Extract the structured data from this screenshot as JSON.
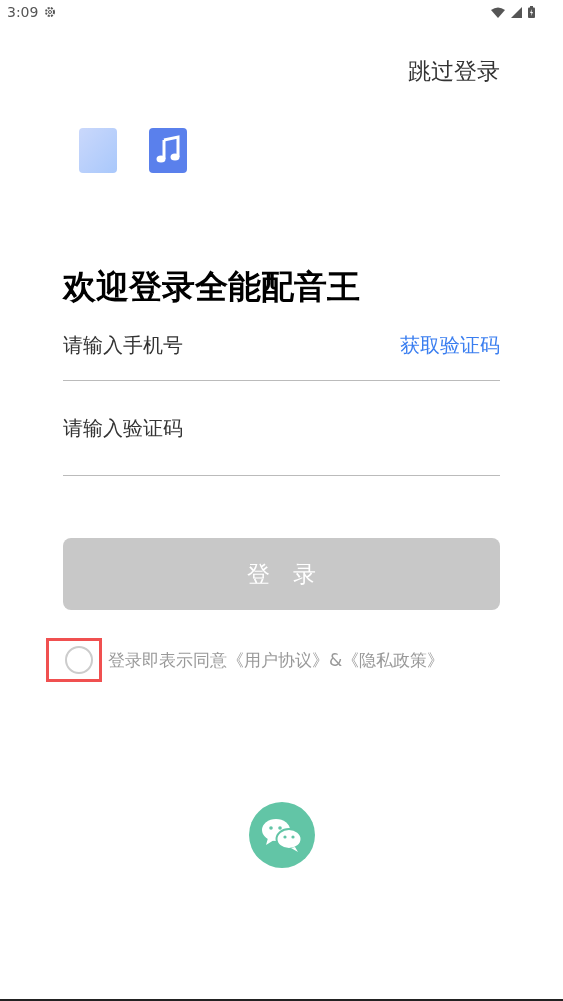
{
  "status_bar": {
    "time": "3:09"
  },
  "skip": "跳过登录",
  "title": "欢迎登录全能配音王",
  "phone_field": {
    "placeholder": "请输入手机号",
    "action": "获取验证码"
  },
  "code_field": {
    "placeholder": "请输入验证码"
  },
  "login_button": {
    "label": "登　录",
    "disabled": true
  },
  "agreement": {
    "checked": false,
    "highlighted": true,
    "text": "登录即表示同意《用户协议》&《隐私政策》"
  }
}
